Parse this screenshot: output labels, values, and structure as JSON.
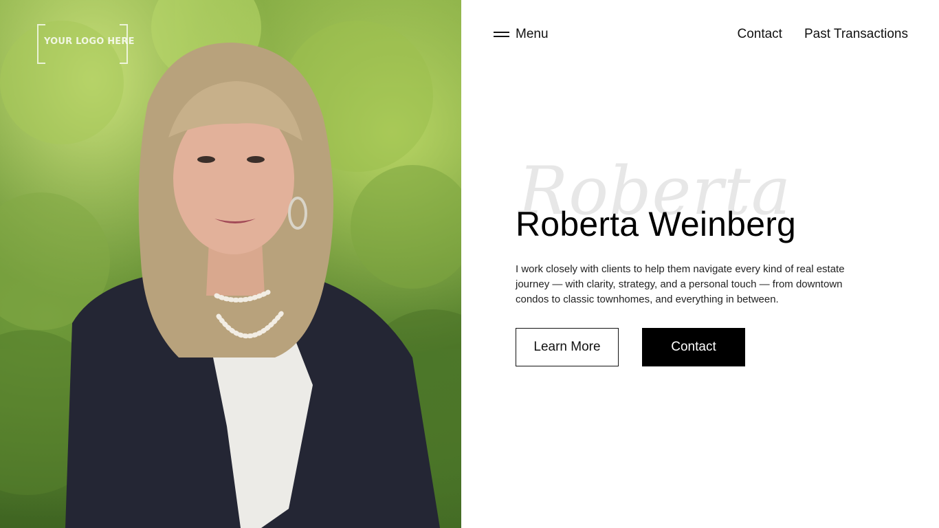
{
  "logo": {
    "text": "YOUR LOGO HERE"
  },
  "nav": {
    "menu_label": "Menu",
    "links": [
      "Contact",
      "Past Transactions"
    ]
  },
  "hero": {
    "watermark": "Roberta",
    "name": "Roberta Weinberg",
    "description": "I work closely with clients to help them navigate every kind of real estate journey — with clarity, strategy, and a personal touch — from downtown condos to classic townhomes, and everything in between.",
    "buttons": {
      "learn_more": "Learn More",
      "contact": "Contact"
    }
  },
  "colors": {
    "background": "#ffffff",
    "text": "#000000",
    "button_solid": "#000000",
    "foliage": "#6f9a3a"
  }
}
